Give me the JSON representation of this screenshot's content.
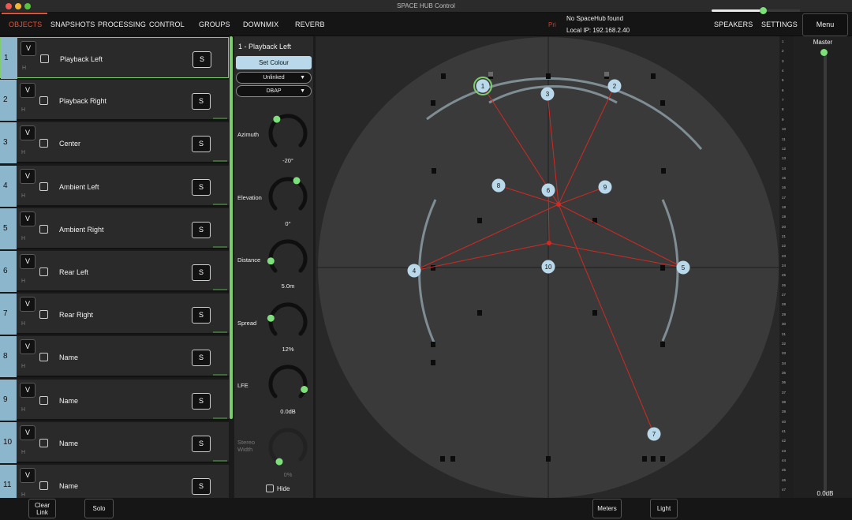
{
  "window": {
    "title": "SPACE HUB Control"
  },
  "nav": {
    "tabs": [
      "OBJECTS",
      "SNAPSHOTS",
      "PROCESSING",
      "CONTROL",
      "GROUPS",
      "DOWNMIX",
      "REVERB"
    ],
    "active_tab": "OBJECTS",
    "right_tabs": [
      "SPEAKERS",
      "SETTINGS"
    ],
    "menu_label": "Menu",
    "pri_badge": "Pri",
    "status": "No SpaceHub found",
    "local_ip": "Local IP: 192.168.2.40"
  },
  "objects": [
    {
      "num": "1",
      "name": "Playback Left",
      "v": "V",
      "h": "H",
      "solo": "S",
      "selected": true
    },
    {
      "num": "2",
      "name": "Playback Right",
      "v": "V",
      "h": "H",
      "solo": "S"
    },
    {
      "num": "3",
      "name": "Center",
      "v": "V",
      "h": "H",
      "solo": "S"
    },
    {
      "num": "4",
      "name": "Ambient Left",
      "v": "V",
      "h": "H",
      "solo": "S"
    },
    {
      "num": "5",
      "name": "Ambient Right",
      "v": "V",
      "h": "H",
      "solo": "S"
    },
    {
      "num": "6",
      "name": "Rear Left",
      "v": "V",
      "h": "H",
      "solo": "S"
    },
    {
      "num": "7",
      "name": "Rear Right",
      "v": "V",
      "h": "H",
      "solo": "S"
    },
    {
      "num": "8",
      "name": "Name",
      "v": "V",
      "h": "H",
      "solo": "S"
    },
    {
      "num": "9",
      "name": "Name",
      "v": "V",
      "h": "H",
      "solo": "S"
    },
    {
      "num": "10",
      "name": "Name",
      "v": "V",
      "h": "H",
      "solo": "S"
    },
    {
      "num": "11",
      "name": "Name",
      "v": "V",
      "h": "H",
      "solo": "S"
    }
  ],
  "panel": {
    "title": "1 -    Playback Left",
    "set_colour": "Set Colour",
    "link_mode": "Unlinked",
    "render_mode": "DBAP",
    "knobs": [
      {
        "label": "Azimuth",
        "value": "-20°"
      },
      {
        "label": "Elevation",
        "value": "0°"
      },
      {
        "label": "Distance",
        "value": "5.0m"
      },
      {
        "label": "Spread",
        "value": "12%"
      },
      {
        "label": "LFE",
        "value": "0.0dB"
      },
      {
        "label": "Stereo Width",
        "value": "0%",
        "disabled": true
      }
    ],
    "hide_label": "Hide"
  },
  "speaker_view": {
    "objects": [
      {
        "label": "1",
        "selected": true
      },
      {
        "label": "2"
      },
      {
        "label": "3"
      },
      {
        "label": "4"
      },
      {
        "label": "5"
      },
      {
        "label": "6"
      },
      {
        "label": "7"
      },
      {
        "label": "8"
      },
      {
        "label": "9"
      },
      {
        "label": "10"
      }
    ],
    "object_color": "#b9d9eb",
    "link_color": "#d22a22",
    "selected_ring_color": "#7dcc6e"
  },
  "master": {
    "label": "Master",
    "value": "0.0dB",
    "level": 1.0
  },
  "scale": [
    "1",
    "2",
    "3",
    "4",
    "5",
    "6",
    "7",
    "8",
    "9",
    "10",
    "11",
    "12",
    "13",
    "14",
    "15",
    "16",
    "17",
    "18",
    "19",
    "20",
    "21",
    "22",
    "23",
    "24",
    "25",
    "26",
    "27",
    "28",
    "29",
    "30",
    "31",
    "32",
    "33",
    "34",
    "35",
    "36",
    "37",
    "38",
    "39",
    "40",
    "41",
    "42",
    "43",
    "44",
    "45",
    "46",
    "47"
  ],
  "bottom": {
    "clear_link": "Clear Link",
    "solo": "Solo",
    "meters": "Meters",
    "light": "Light",
    "zoom_level": 0.55
  },
  "colors": {
    "accent": "#e0533b",
    "green": "#7dcc6e",
    "object_tab": "#8cb6cc"
  }
}
